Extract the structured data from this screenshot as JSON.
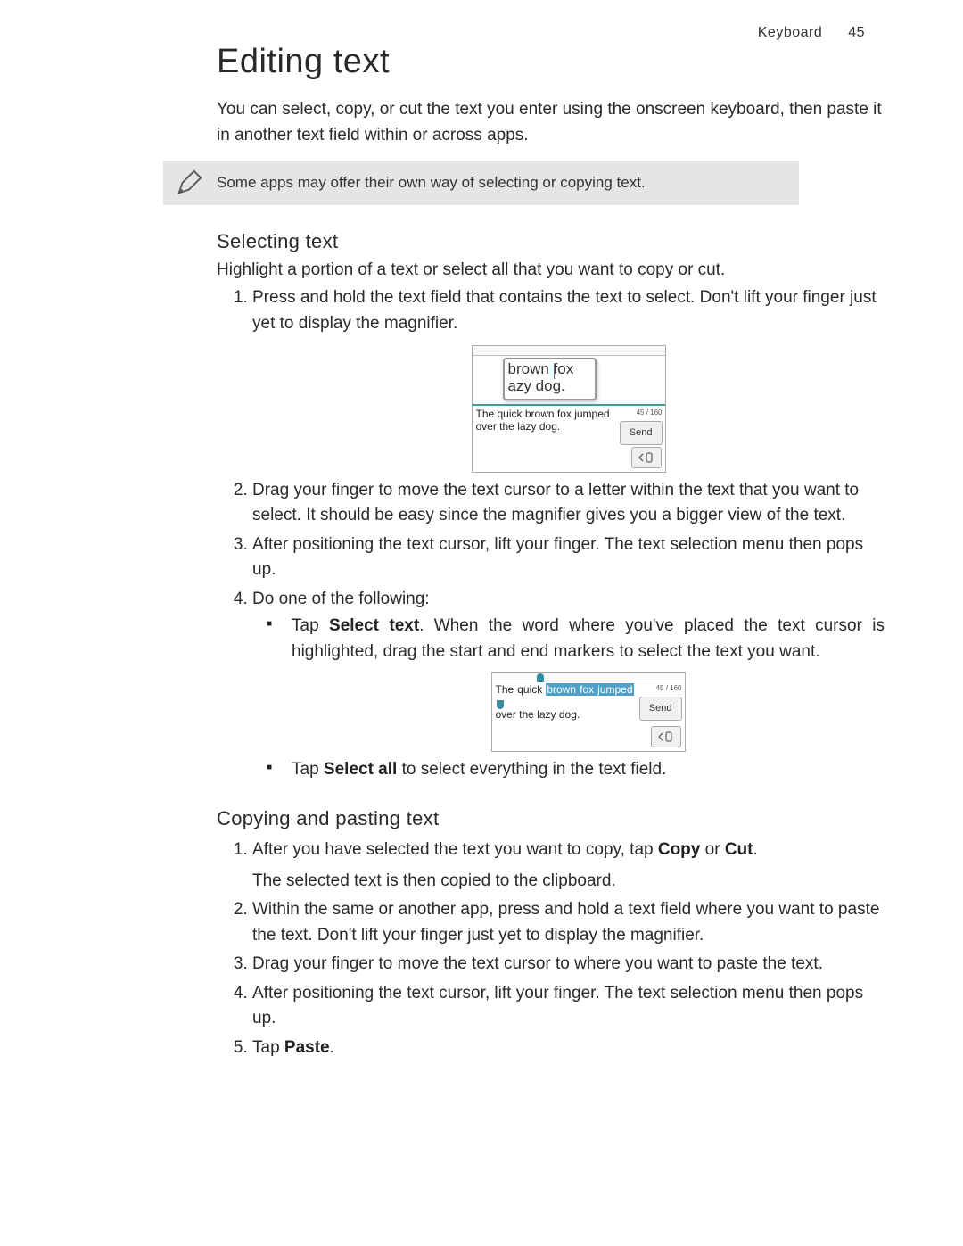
{
  "header": {
    "chapter": "Keyboard",
    "page": "45"
  },
  "title": "Editing text",
  "intro": "You can select, copy, or cut the text you enter using the onscreen keyboard, then paste it in another text field within or across apps.",
  "note": {
    "text": "Some apps may offer their own way of selecting or copying text.",
    "icon": "pen-icon"
  },
  "section_select": {
    "heading": "Selecting text",
    "lead": "Highlight a portion of a text or select all that you want to copy or cut.",
    "steps": {
      "s1": "Press and hold the text field that contains the text to select. Don't lift your finger just yet to display the magnifier.",
      "s2": "Drag your finger to move the text cursor to a letter within the text that you want to select. It should be easy since the magnifier gives you a bigger view of the text.",
      "s3": "After positioning the text cursor, lift your finger. The text selection menu then pops up.",
      "s4": "Do one of the following:",
      "bullet1_pre": "Tap ",
      "bullet1_bold": "Select text",
      "bullet1_post": ". When the word where you've placed the text cursor is highlighted, drag the start and end markers to select the text you want.",
      "bullet2_pre": "Tap ",
      "bullet2_bold": "Select all",
      "bullet2_post": " to select everything in the text field."
    }
  },
  "section_copy": {
    "heading": "Copying and pasting text",
    "steps": {
      "s1_pre": "After you have selected the text you want to copy, tap ",
      "s1_bold1": "Copy",
      "s1_mid": " or ",
      "s1_bold2": "Cut",
      "s1_post": ".",
      "s1_line2": "The selected text is then copied to the clipboard.",
      "s2": "Within the same or another app, press and hold a text field where you want to paste the text. Don't lift your finger just yet to display the magnifier.",
      "s3": "Drag your finger to move the text cursor to where you want to paste the text.",
      "s4": "After positioning the text cursor, lift your finger. The text selection menu then pops up.",
      "s5_pre": "Tap ",
      "s5_bold": "Paste",
      "s5_post": "."
    }
  },
  "mock1": {
    "mag_line1": " brown fox",
    "mag_line2": "azy dog.",
    "msg": "The quick brown fox jumped over the lazy dog.",
    "counter": "45 / 160",
    "send": "Send",
    "attach": "◂📎"
  },
  "mock2": {
    "pre": "The quick ",
    "hl": "brown fox jumped",
    "post_line2": "over the lazy dog.",
    "counter": "45 / 160",
    "send": "Send",
    "attach": "◂📎"
  }
}
